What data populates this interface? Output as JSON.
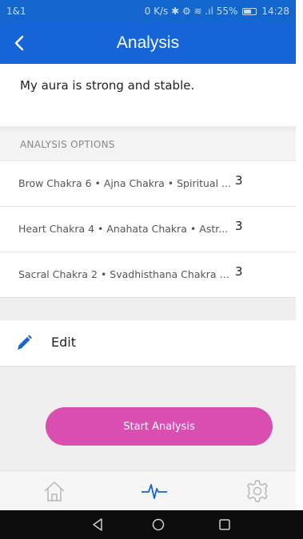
{
  "status_bar": {
    "carrier": "1&1",
    "info": "0 K/s ✱ ⚙ ≋ .ıl 55%",
    "time": "14:28"
  },
  "app_bar": {
    "title": "Analysis",
    "back_icon": "chevron-left-icon"
  },
  "message": "My aura is strong and stable.",
  "options": {
    "header": "ANALYSIS OPTIONS",
    "items": [
      {
        "text": "Brow Chakra 6 • Ajna Chakra • Spiritual ...",
        "count": "3"
      },
      {
        "text": "Heart Chakra 4 • Anahata Chakra • Astr...",
        "count": "3"
      },
      {
        "text": "Sacral Chakra 2 • Svadhisthana Chakra •...",
        "count": "3"
      }
    ]
  },
  "edit": {
    "label": "Edit",
    "icon": "pencil-icon"
  },
  "start_button": {
    "label": "Start Analysis"
  },
  "tab_bar": {
    "active": "analysis",
    "icons": [
      "home-icon",
      "pulse-icon",
      "settings-icon"
    ]
  },
  "colors": {
    "primary": "#1565d8",
    "accent": "#d84fb0",
    "background": "#efefef"
  }
}
